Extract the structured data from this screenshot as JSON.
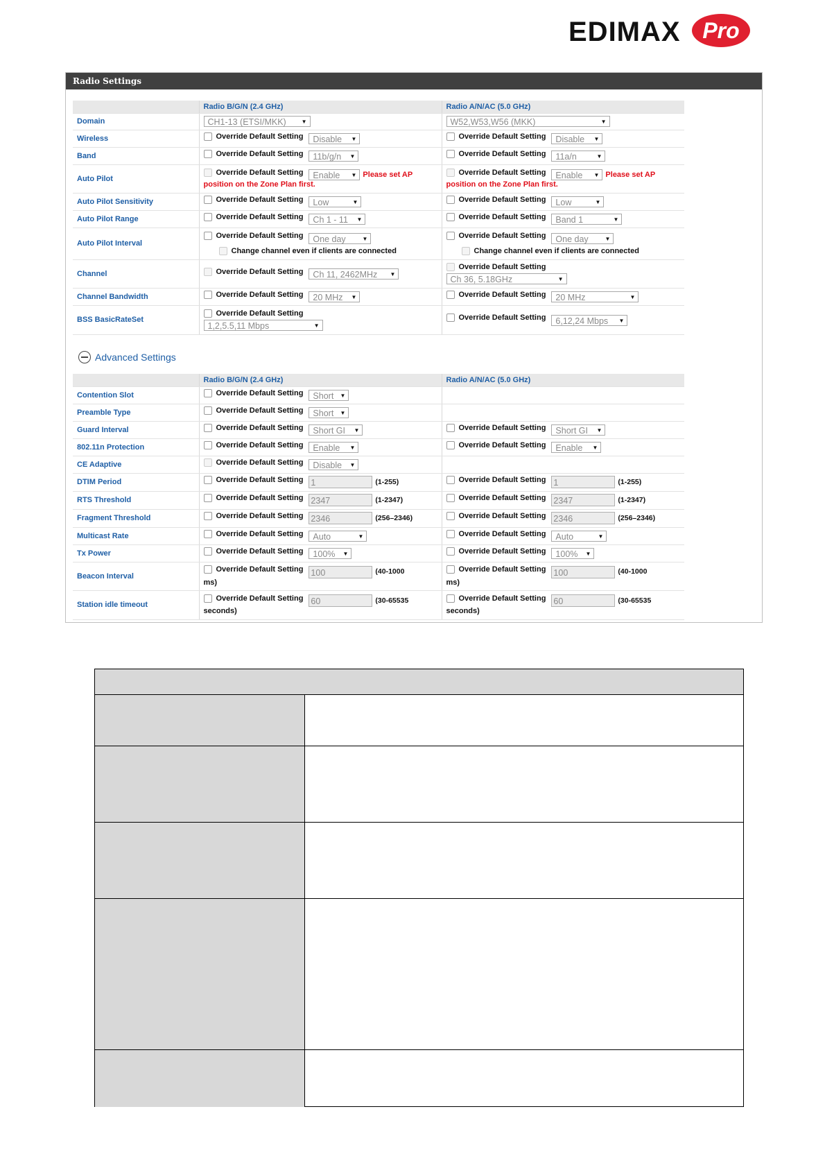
{
  "logo": {
    "text": "EDIMAX",
    "pro": "Pro"
  },
  "panel_title": "Radio Settings",
  "col_24": "Radio B/G/N (2.4 GHz)",
  "col_50": "Radio A/N/AC (5.0 GHz)",
  "override": "Override Default Setting",
  "warn_part1": "Please set AP",
  "warn_part2": "position on the Zone Plan first.",
  "change_channel": "Change channel even if clients are connected",
  "rows": {
    "domain": {
      "label": "Domain",
      "a": "CH1-13 (ETSI/MKK)",
      "b": "W52,W53,W56 (MKK)"
    },
    "wireless": {
      "label": "Wireless",
      "a": "Disable",
      "b": "Disable"
    },
    "band": {
      "label": "Band",
      "a": "11b/g/n",
      "b": "11a/n"
    },
    "autopilot": {
      "label": "Auto Pilot",
      "a": "Enable",
      "b": "Enable"
    },
    "ap_sens": {
      "label": "Auto Pilot Sensitivity",
      "a": "Low",
      "b": "Low"
    },
    "ap_range": {
      "label": "Auto Pilot Range",
      "a": "Ch 1 - 11",
      "b": "Band 1"
    },
    "ap_int": {
      "label": "Auto Pilot Interval",
      "a": "One day",
      "b": "One day"
    },
    "channel": {
      "label": "Channel",
      "a": "Ch 11, 2462MHz",
      "b": "Ch 36, 5.18GHz"
    },
    "bw": {
      "label": "Channel Bandwidth",
      "a": "20 MHz",
      "b": "20 MHz"
    },
    "bss": {
      "label": "BSS BasicRateSet",
      "a": "1,2,5.5,11 Mbps",
      "b": "6,12,24 Mbps"
    }
  },
  "advanced_label": "Advanced Settings",
  "adv": {
    "contention": {
      "label": "Contention Slot",
      "a": "Short"
    },
    "preamble": {
      "label": "Preamble Type",
      "a": "Short"
    },
    "guard": {
      "label": "Guard Interval",
      "a": "Short GI",
      "b": "Short GI"
    },
    "prot": {
      "label": "802.11n Protection",
      "a": "Enable",
      "b": "Enable"
    },
    "ce": {
      "label": "CE Adaptive",
      "a": "Disable"
    },
    "dtim": {
      "label": "DTIM Period",
      "a": "1",
      "b": "1",
      "range": "(1-255)"
    },
    "rts": {
      "label": "RTS Threshold",
      "a": "2347",
      "b": "2347",
      "range": "(1-2347)"
    },
    "frag": {
      "label": "Fragment Threshold",
      "a": "2346",
      "b": "2346",
      "range": "(256–2346)"
    },
    "mcast": {
      "label": "Multicast Rate",
      "a": "Auto",
      "b": "Auto"
    },
    "txp": {
      "label": "Tx Power",
      "a": "100%",
      "b": "100%"
    },
    "beacon": {
      "label": "Beacon Interval",
      "a": "100",
      "b": "100",
      "range1": "(40-1000",
      "range2": "ms)"
    },
    "idle": {
      "label": "Station idle timeout",
      "a": "60",
      "b": "60",
      "range1": "(30-65535",
      "range2": "seconds)"
    }
  }
}
